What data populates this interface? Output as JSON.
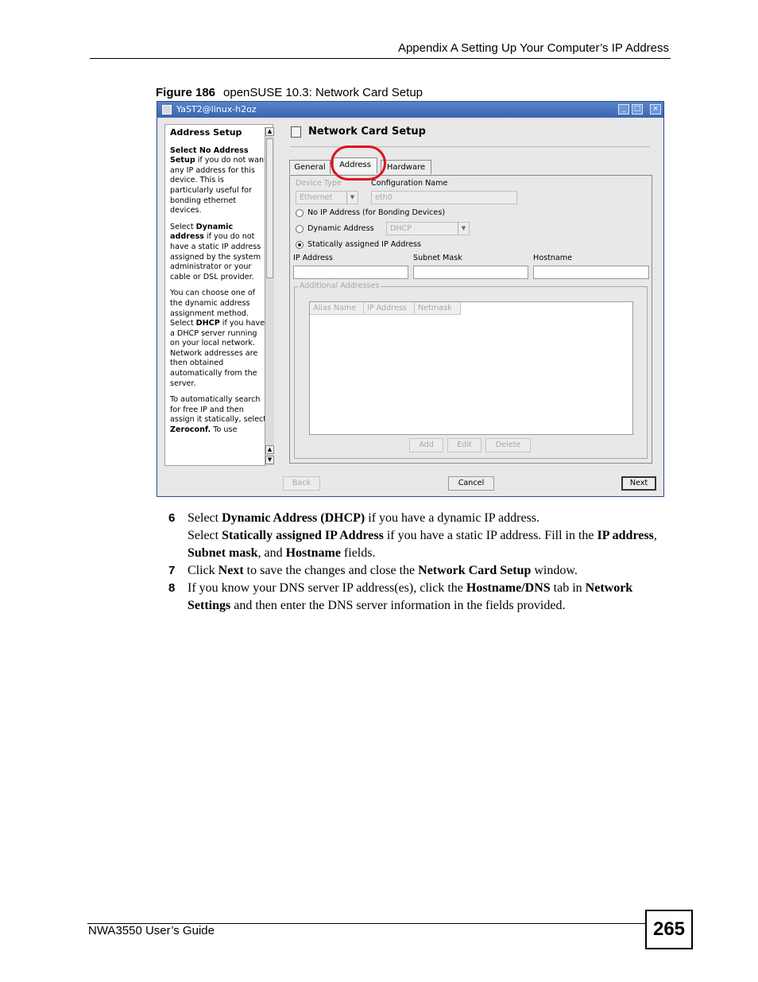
{
  "header": {
    "text": "Appendix A Setting Up Your Computer’s IP Address"
  },
  "figure": {
    "label": "Figure 186",
    "caption": "openSUSE 10.3: Network Card Setup"
  },
  "window": {
    "title": "YaST2@linux-h2oz",
    "buttons": {
      "minimize": "_",
      "maximize": "□",
      "close": "×"
    },
    "help": {
      "title": "Address Setup",
      "p1_bold": "Select No Address Setup",
      "p1_rest": " if you do not want any IP address for this device. This is particularly useful for bonding ethernet devices.",
      "p2_pre": "Select ",
      "p2_bold": "Dynamic address",
      "p2_rest": " if you do not have a static IP address assigned by the system administrator or your cable or DSL provider.",
      "p3_pre": "You can choose one of the dynamic address assignment method. Select ",
      "p3_bold": "DHCP",
      "p3_rest": " if you have a DHCP server running on your local network. Network addresses are then obtained automatically from the server.",
      "p4_pre": "To automatically search for free IP and then assign it statically, select ",
      "p4_bold": "Zeroconf.",
      "p4_rest": " To use"
    },
    "main_title": "Network Card Setup",
    "tabs": [
      "General",
      "Address",
      "Hardware"
    ],
    "device_type_label": "Device Type",
    "device_type_value": "Ethernet",
    "config_name_label": "Configuration Name",
    "config_name_value": "eth0",
    "radio_no_ip": "No IP Address (for Bonding Devices)",
    "radio_dynamic": "Dynamic Address",
    "dynamic_value": "DHCP",
    "radio_static": "Statically assigned IP Address",
    "ip_label": "IP Address",
    "subnet_label": "Subnet Mask",
    "hostname_label": "Hostname",
    "additional_title": "Additional Addresses",
    "table_headers": [
      "Alias Name",
      "IP Address",
      "Netmask"
    ],
    "table_buttons": [
      "Add",
      "Edit",
      "Delete"
    ],
    "footer_buttons": {
      "back": "Back",
      "cancel": "Cancel",
      "next": "Next"
    }
  },
  "steps": {
    "s6": {
      "num": "6",
      "a_pre": "Select ",
      "a_bold": "Dynamic Address (DHCP)",
      "a_post": " if you have a dynamic IP address.",
      "b_pre": "Select ",
      "b_bold1": "Statically assigned IP Address",
      "b_mid1": " if you have a static IP address. Fill in the ",
      "b_bold2": "IP address",
      "b_mid2": ", ",
      "b_bold3": "Subnet mask",
      "b_mid3": ", and ",
      "b_bold4": "Hostname",
      "b_post": " fields."
    },
    "s7": {
      "num": "7",
      "pre": "Click ",
      "bold1": "Next",
      "mid": " to save the changes and close the ",
      "bold2": "Network Card Setup",
      "post": " window."
    },
    "s8": {
      "num": "8",
      "pre": "If you know your DNS server IP address(es), click the ",
      "bold1": "Hostname/DNS",
      "mid": " tab in ",
      "bold2": "Network Settings",
      "post": " and then enter the DNS server information in the fields provided."
    }
  },
  "footer": {
    "guide": "NWA3550 User’s Guide",
    "page": "265"
  }
}
